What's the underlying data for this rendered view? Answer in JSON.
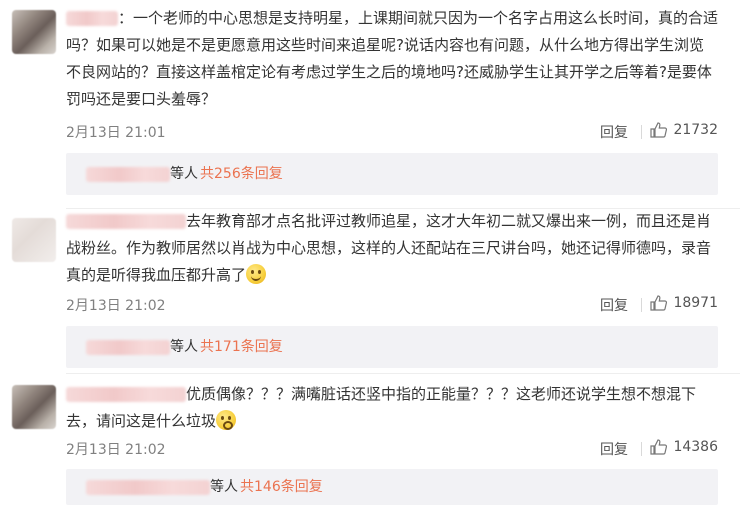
{
  "comments": [
    {
      "text": "：一个老师的中心思想是支持明星，上课期间就只因为一个名字占用这么长时间，真的合适吗？如果可以她是不是更愿意用这些时间来追星呢?说话内容也有问题，从什么地方得出学生浏览不良网站的？直接这样盖棺定论有考虑过学生之后的境地吗?还威胁学生让其开学之后等着?是要体罚吗还是要口头羞辱？",
      "date": "2月13日 21:01",
      "reply_label": "回复",
      "likes": "21732",
      "replies_prefix": "等人",
      "replies_count": "共256条回复"
    },
    {
      "text": "去年教育部才点名批评过教师追星，这才大年初二就又爆出来一例，而且还是肖战粉丝。作为教师居然以肖战为中心思想，这样的人还配站在三尺讲台吗，她还记得师德吗，录音真的是听得我血压都升高了",
      "date": "2月13日 21:02",
      "reply_label": "回复",
      "likes": "18971",
      "replies_prefix": "等人",
      "replies_count": "共171条回复"
    },
    {
      "text": "优质偶像？？？满嘴脏话还竖中指的正能量？？？这老师还说学生想不想混下去，请问这是什么垃圾",
      "date": "2月13日 21:02",
      "reply_label": "回复",
      "likes": "14386",
      "replies_prefix": "等人",
      "replies_count": "共146条回复"
    }
  ],
  "icons": {
    "like": "thumbs-up-icon",
    "emoji_1": "smile-emoji-icon",
    "emoji_2": "surprised-emoji-icon"
  },
  "colors": {
    "reply_count": "#eb7350",
    "meta": "#808080",
    "reply_box_bg": "#f2f2f5"
  }
}
